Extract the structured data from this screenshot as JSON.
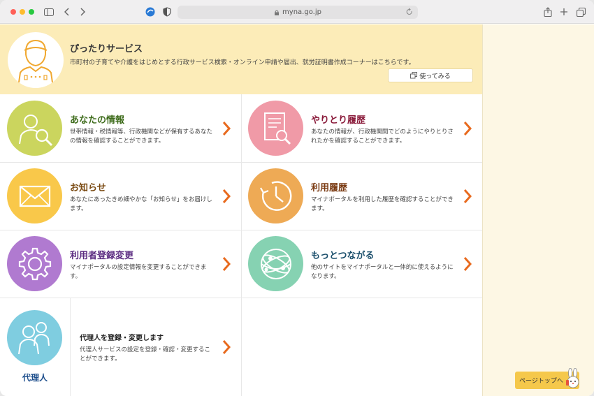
{
  "browser": {
    "url": "myna.go.jp"
  },
  "banner": {
    "title": "ぴったりサービス",
    "description": "市町村の子育てや介護をはじめとする行政サービス検索・オンライン申請や届出、就労証明書作成コーナーはこちらです。",
    "button_label": "使ってみる"
  },
  "cards": [
    {
      "title": "あなたの情報",
      "description": "世帯情報・税情報等、行政機関などが保有するあなたの情報を確認することができます。",
      "color": "#cbd55e",
      "title_color": "#3d6b1a",
      "icon": "person-search-icon"
    },
    {
      "title": "やりとり履歴",
      "description": "あなたの情報が、行政機関間でどのようにやりとりされたかを確認することができます。",
      "color": "#f09aa7",
      "title_color": "#8a1a3a",
      "icon": "document-search-icon"
    },
    {
      "title": "お知らせ",
      "description": "あなたにあったきめ細やかな「お知らせ」をお届けします。",
      "color": "#f9c84a",
      "title_color": "#7a4a12",
      "icon": "envelope-icon"
    },
    {
      "title": "利用履歴",
      "description": "マイナポータルを利用した履歴を確認することができます。",
      "color": "#eeaa55",
      "title_color": "#7a3a12",
      "icon": "clock-icon"
    },
    {
      "title": "利用者登録変更",
      "description": "マイナポータルの設定情報を変更することができます。",
      "color": "#b07ad0",
      "title_color": "#5a2a80",
      "icon": "gear-icon"
    },
    {
      "title": "もっとつながる",
      "description": "他のサイトをマイナポータルと一体的に使えるようになります。",
      "color": "#86d2b2",
      "title_color": "#1a4e6b",
      "icon": "globe-network-icon"
    }
  ],
  "proxy": {
    "label": "代理人",
    "title": "代理人を登録・変更します",
    "description": "代理人サービスの設定を登録・確認・変更することができます。"
  },
  "page_top": {
    "label": "ページトップへ"
  },
  "colors": {
    "chevron": "#e86a1e",
    "banner_bg": "#fcecb8",
    "sidebar_bg": "#fdf7e4"
  }
}
